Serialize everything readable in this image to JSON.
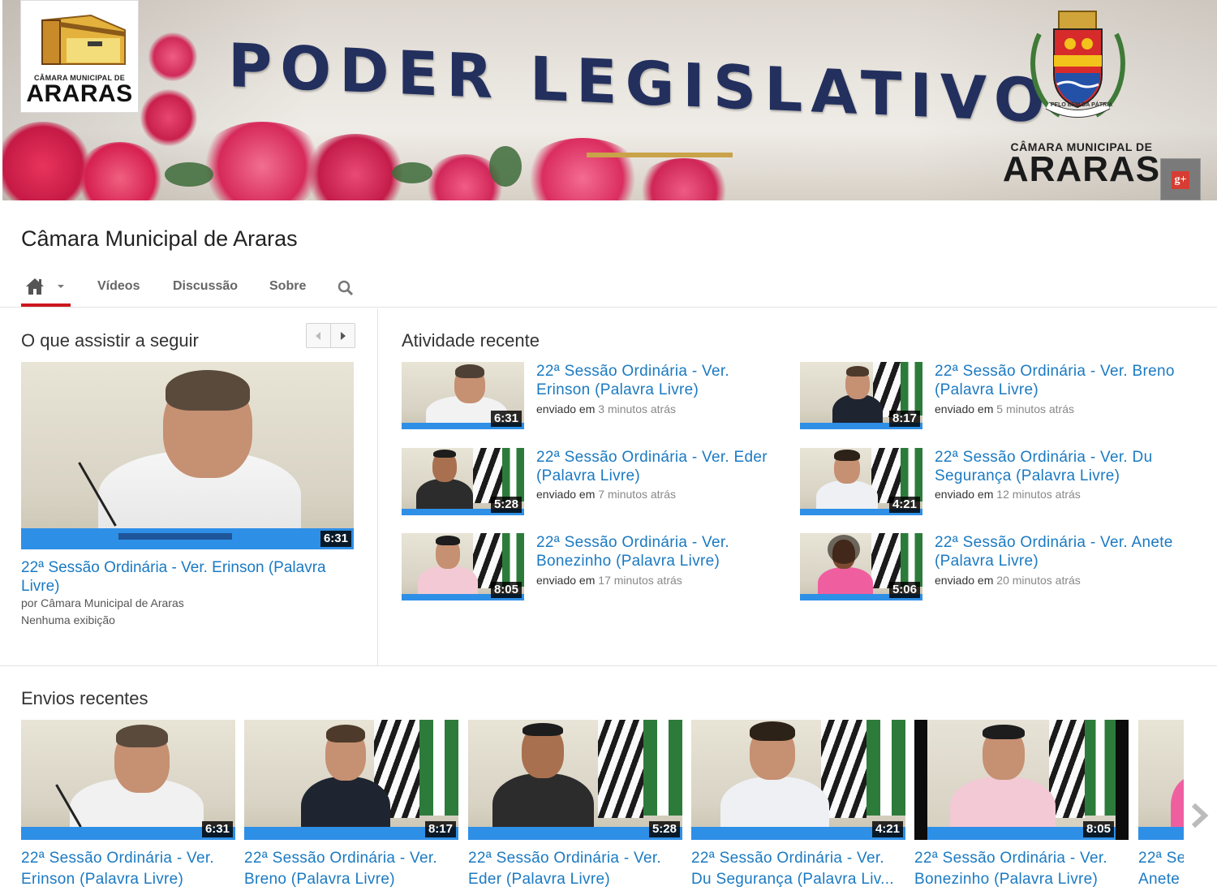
{
  "banner": {
    "logo_small": "CÂMARA MUNICIPAL DE",
    "logo_big": "ARARAS",
    "headline": "PODER LEGISLATIVO",
    "crest_motto": "PELO BEM DA PÁTRIA",
    "camara_small": "CÂMARA MUNICIPAL DE",
    "camara_big": "ARARAS",
    "gplus_label": "g+"
  },
  "channel": {
    "title": "Câmara Municipal de Araras"
  },
  "nav": {
    "tabs": [
      "Vídeos",
      "Discussão",
      "Sobre"
    ]
  },
  "watch_next": {
    "heading": "O que assistir a seguir",
    "video": {
      "title": "22ª Sessão Ordinária - Ver. Erinson (Palavra Livre)",
      "duration": "6:31",
      "by": "por Câmara Municipal de Araras",
      "views": "Nenhuma exibição"
    }
  },
  "activity": {
    "heading": "Atividade recente",
    "sent_prefix": "enviado em",
    "items": [
      {
        "title": "22ª Sessão Ordinária - Ver. Erinson (Palavra Livre)",
        "duration": "6:31",
        "ago": "3 minutos atrás"
      },
      {
        "title": "22ª Sessão Ordinária - Ver. Breno (Palavra Livre)",
        "duration": "8:17",
        "ago": "5 minutos atrás"
      },
      {
        "title": "22ª Sessão Ordinária - Ver. Eder (Palavra Livre)",
        "duration": "5:28",
        "ago": "7 minutos atrás"
      },
      {
        "title": "22ª Sessão Ordinária - Ver. Du Segurança (Palavra Livre)",
        "duration": "4:21",
        "ago": "12 minutos atrás"
      },
      {
        "title": "22ª Sessão Ordinária - Ver. Bonezinho (Palavra Livre)",
        "duration": "8:05",
        "ago": "17 minutos atrás"
      },
      {
        "title": "22ª Sessão Ordinária - Ver. Anete (Palavra Livre)",
        "duration": "5:06",
        "ago": "20 minutos atrás"
      }
    ]
  },
  "uploads": {
    "heading": "Envios recentes",
    "items": [
      {
        "line1": "22ª Sessão Ordinária - Ver.",
        "line2": "Erinson (Palavra Livre)",
        "duration": "6:31"
      },
      {
        "line1": "22ª Sessão Ordinária - Ver.",
        "line2": "Breno (Palavra Livre)",
        "duration": "8:17"
      },
      {
        "line1": "22ª Sessão Ordinária - Ver.",
        "line2": "Eder (Palavra Livre)",
        "duration": "5:28"
      },
      {
        "line1": "22ª Sessão Ordinária - Ver.",
        "line2": "Du Segurança (Palavra Liv...",
        "duration": "4:21"
      },
      {
        "line1": "22ª Sessão Ordinária - Ver.",
        "line2": "Bonezinho (Palavra Livre)",
        "duration": "8:05"
      },
      {
        "line1": "22ª Se",
        "line2": "Anete"
      }
    ]
  },
  "colors": {
    "link": "#1b7ac2",
    "accent_red": "#cc181e",
    "banner_text": "#23305e"
  }
}
